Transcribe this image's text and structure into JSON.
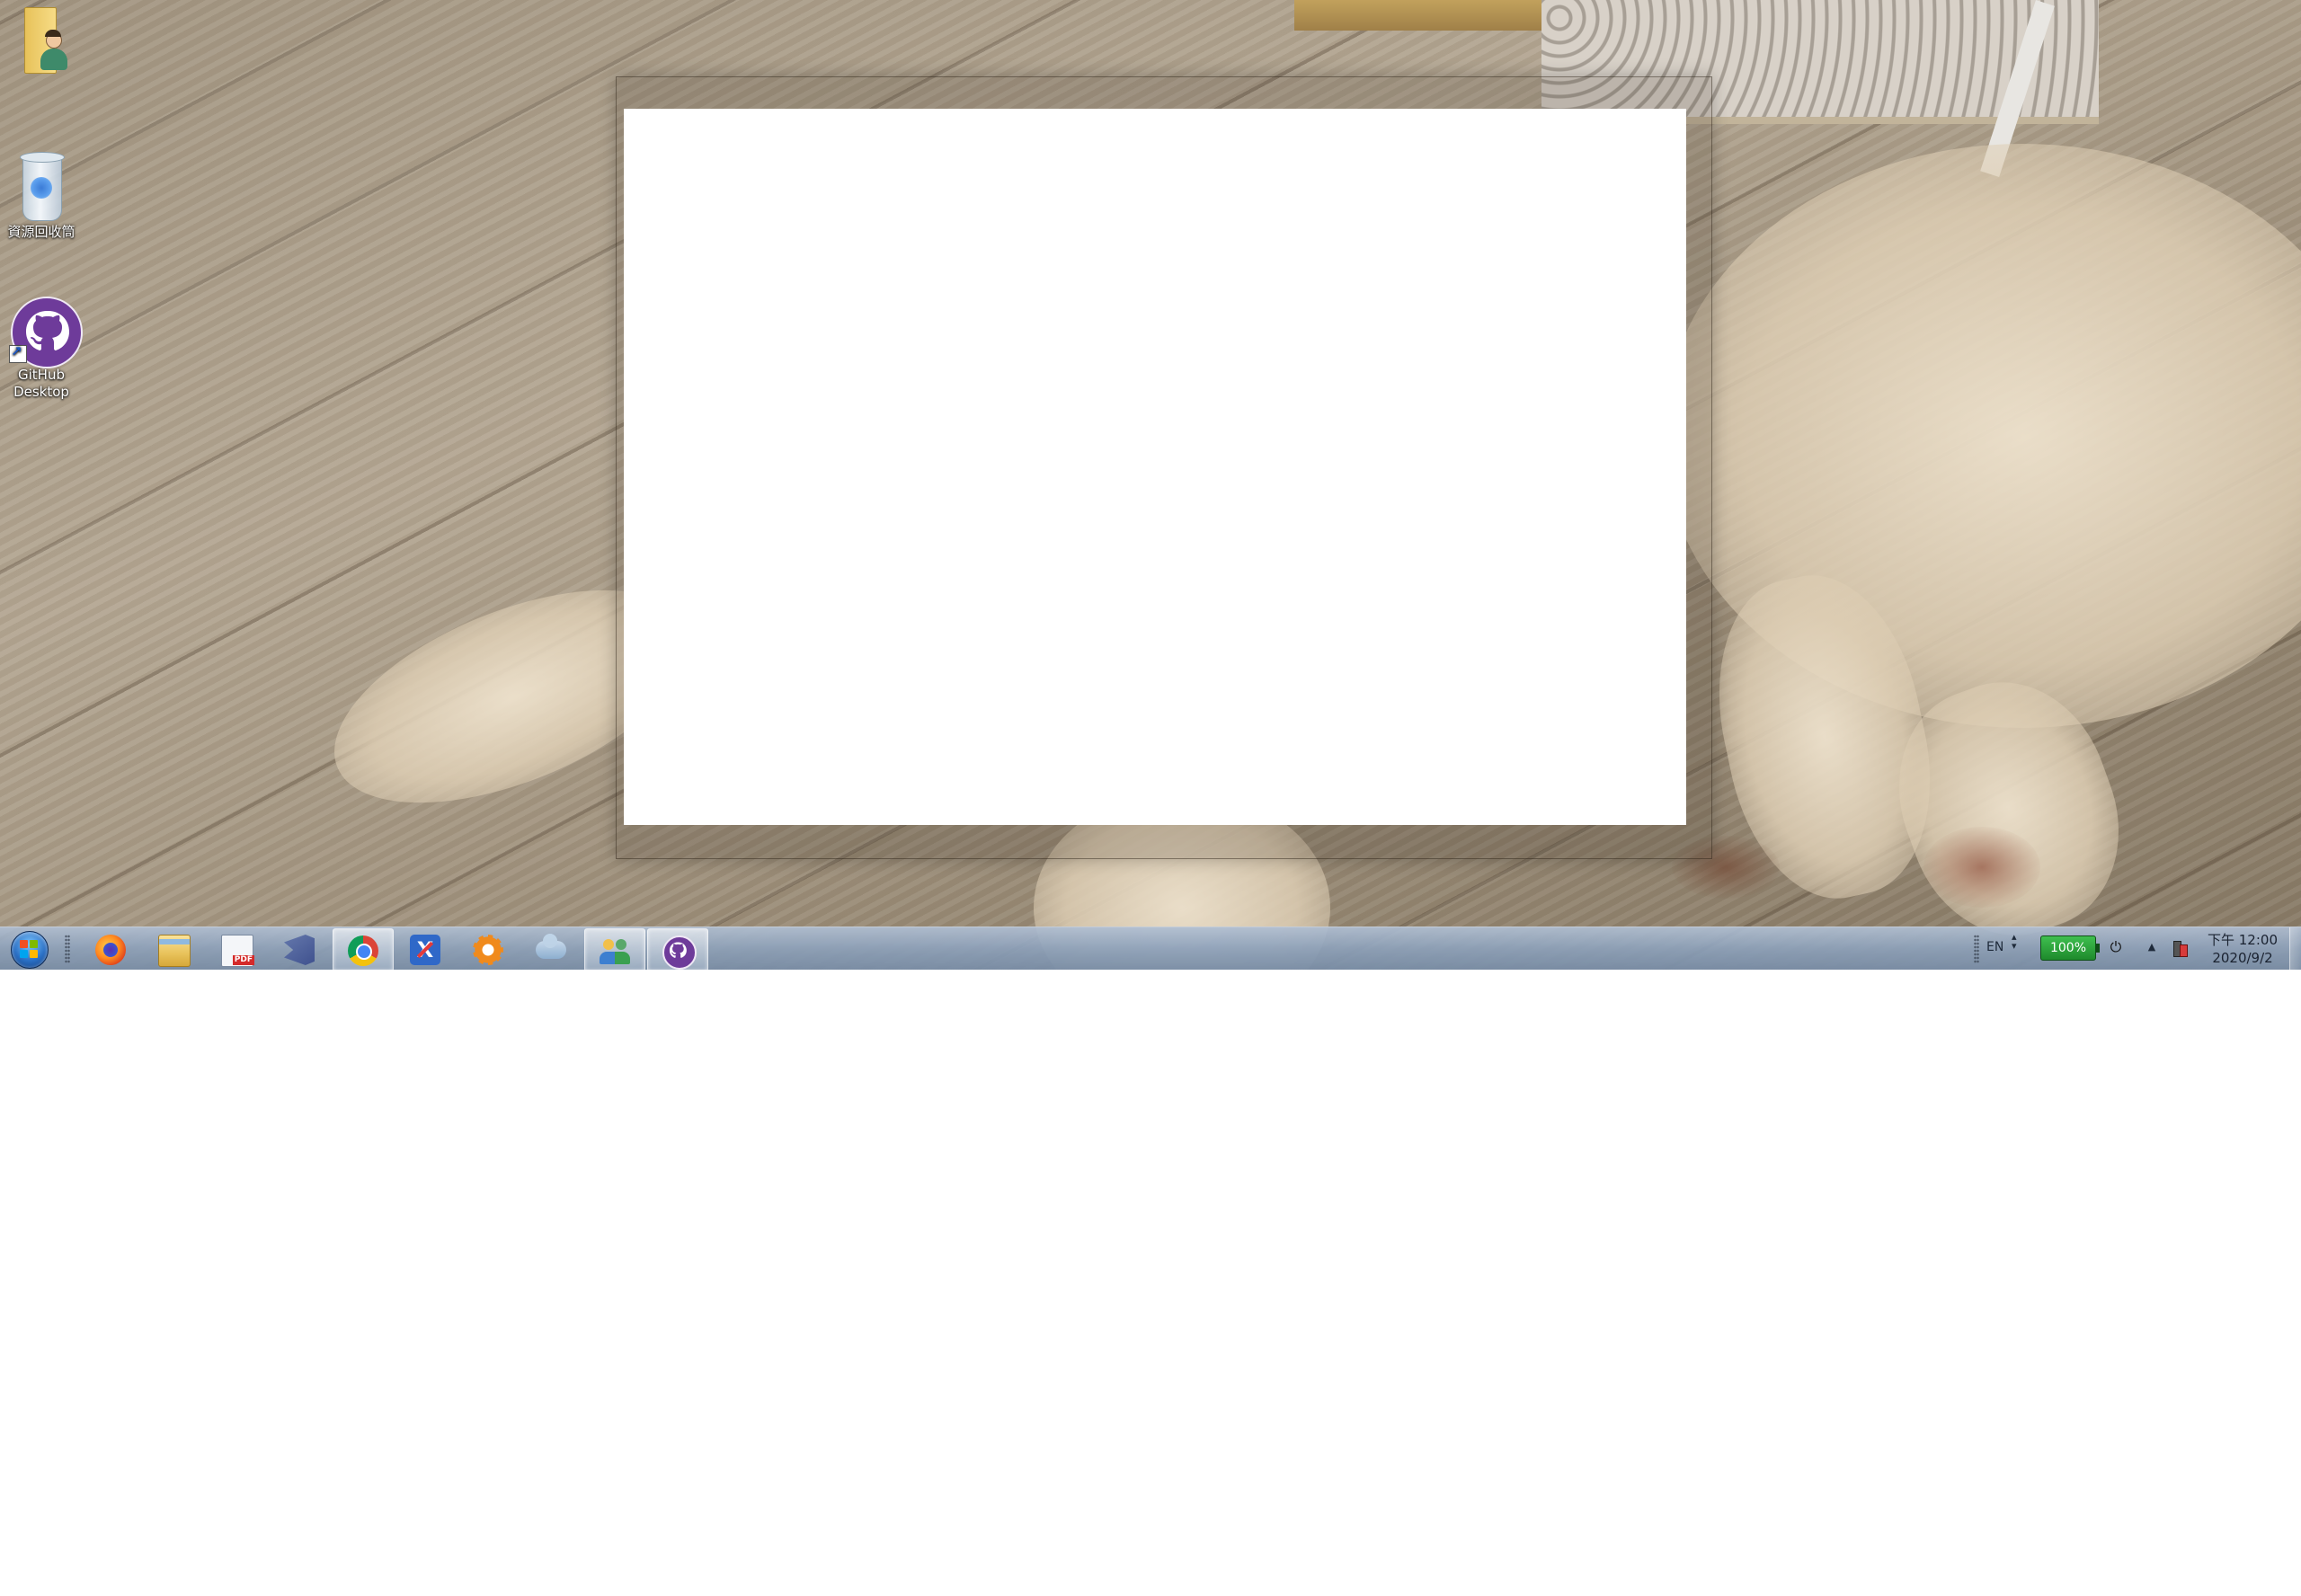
{
  "desktop": {
    "icons": [
      {
        "id": "user-folder",
        "label": ""
      },
      {
        "id": "recycle-bin",
        "label": "資源回收筒"
      },
      {
        "id": "github-desktop",
        "label": "GitHub Desktop"
      }
    ]
  },
  "taskbar": {
    "pinned": [
      {
        "name": "firefox-icon"
      },
      {
        "name": "file-explorer-icon"
      },
      {
        "name": "pdf-editor-icon"
      },
      {
        "name": "vscode-icon"
      },
      {
        "name": "chrome-icon"
      },
      {
        "name": "xmind-icon",
        "glyph": "X"
      },
      {
        "name": "settings-gear-icon"
      },
      {
        "name": "cloud-icon"
      },
      {
        "name": "people-icon"
      },
      {
        "name": "github-icon"
      }
    ],
    "tray": {
      "language": "EN",
      "battery": "100%",
      "time": "下午 12:00",
      "date": "2020/9/2"
    }
  },
  "colors": {
    "taskbar": "#8ca0b9",
    "github_purple": "#6e3b9a",
    "battery_green": "#2aa33a"
  }
}
